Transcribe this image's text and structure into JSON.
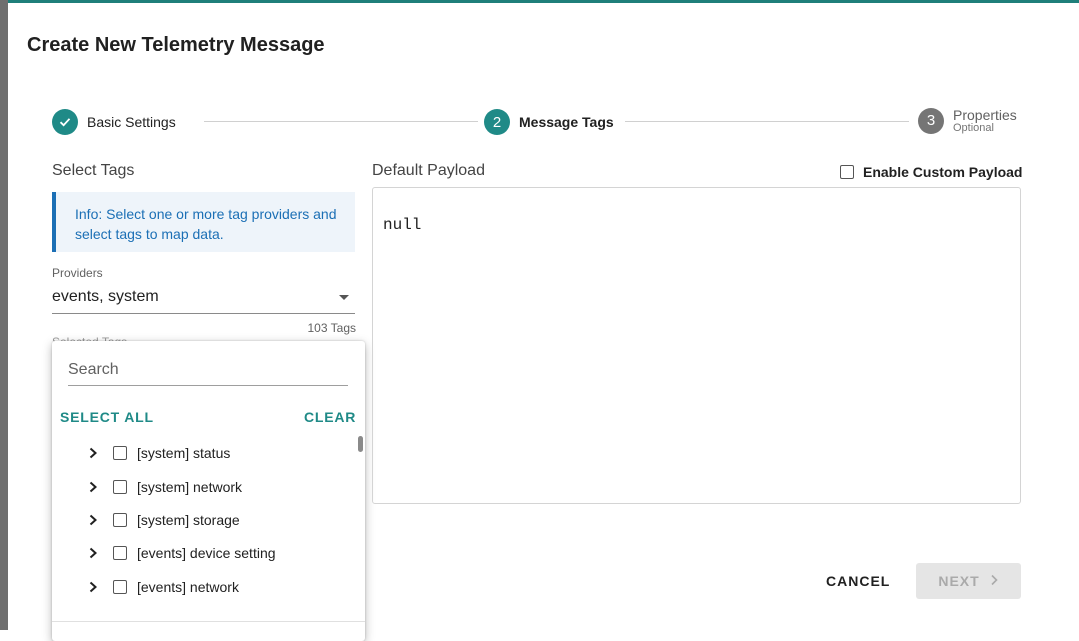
{
  "dialog": {
    "title": "Create New Telemetry Message"
  },
  "stepper": {
    "steps": [
      {
        "label": "Basic Settings",
        "state": "done",
        "icon": "check-icon"
      },
      {
        "number": "2",
        "label": "Message Tags",
        "state": "active"
      },
      {
        "number": "3",
        "label": "Properties",
        "optional": "Optional",
        "state": "idle"
      }
    ]
  },
  "tags_panel": {
    "heading": "Select Tags",
    "info": "Info: Select one or more tag providers and select tags to map data.",
    "providers_label": "Providers",
    "providers_value": "events, system",
    "tag_count": "103 Tags",
    "selected_tags_label": "Selected Tags"
  },
  "dropdown": {
    "search_placeholder": "Search",
    "select_all": "SELECT ALL",
    "clear": "CLEAR",
    "items": [
      {
        "label": "[system] status",
        "checked": false
      },
      {
        "label": "[system] network",
        "checked": false
      },
      {
        "label": "[system] storage",
        "checked": false
      },
      {
        "label": "[events] device setting",
        "checked": false
      },
      {
        "label": "[events] network",
        "checked": false
      }
    ]
  },
  "payload_panel": {
    "heading": "Default Payload",
    "custom_label": "Enable Custom Payload",
    "payload_text": "null"
  },
  "actions": {
    "cancel": "CANCEL",
    "next": "NEXT"
  },
  "colors": {
    "accent": "#1f8a87",
    "info_blue": "#1b6fb5",
    "info_bg": "#eef4fa",
    "disabled_bg": "#e5e5e5"
  }
}
